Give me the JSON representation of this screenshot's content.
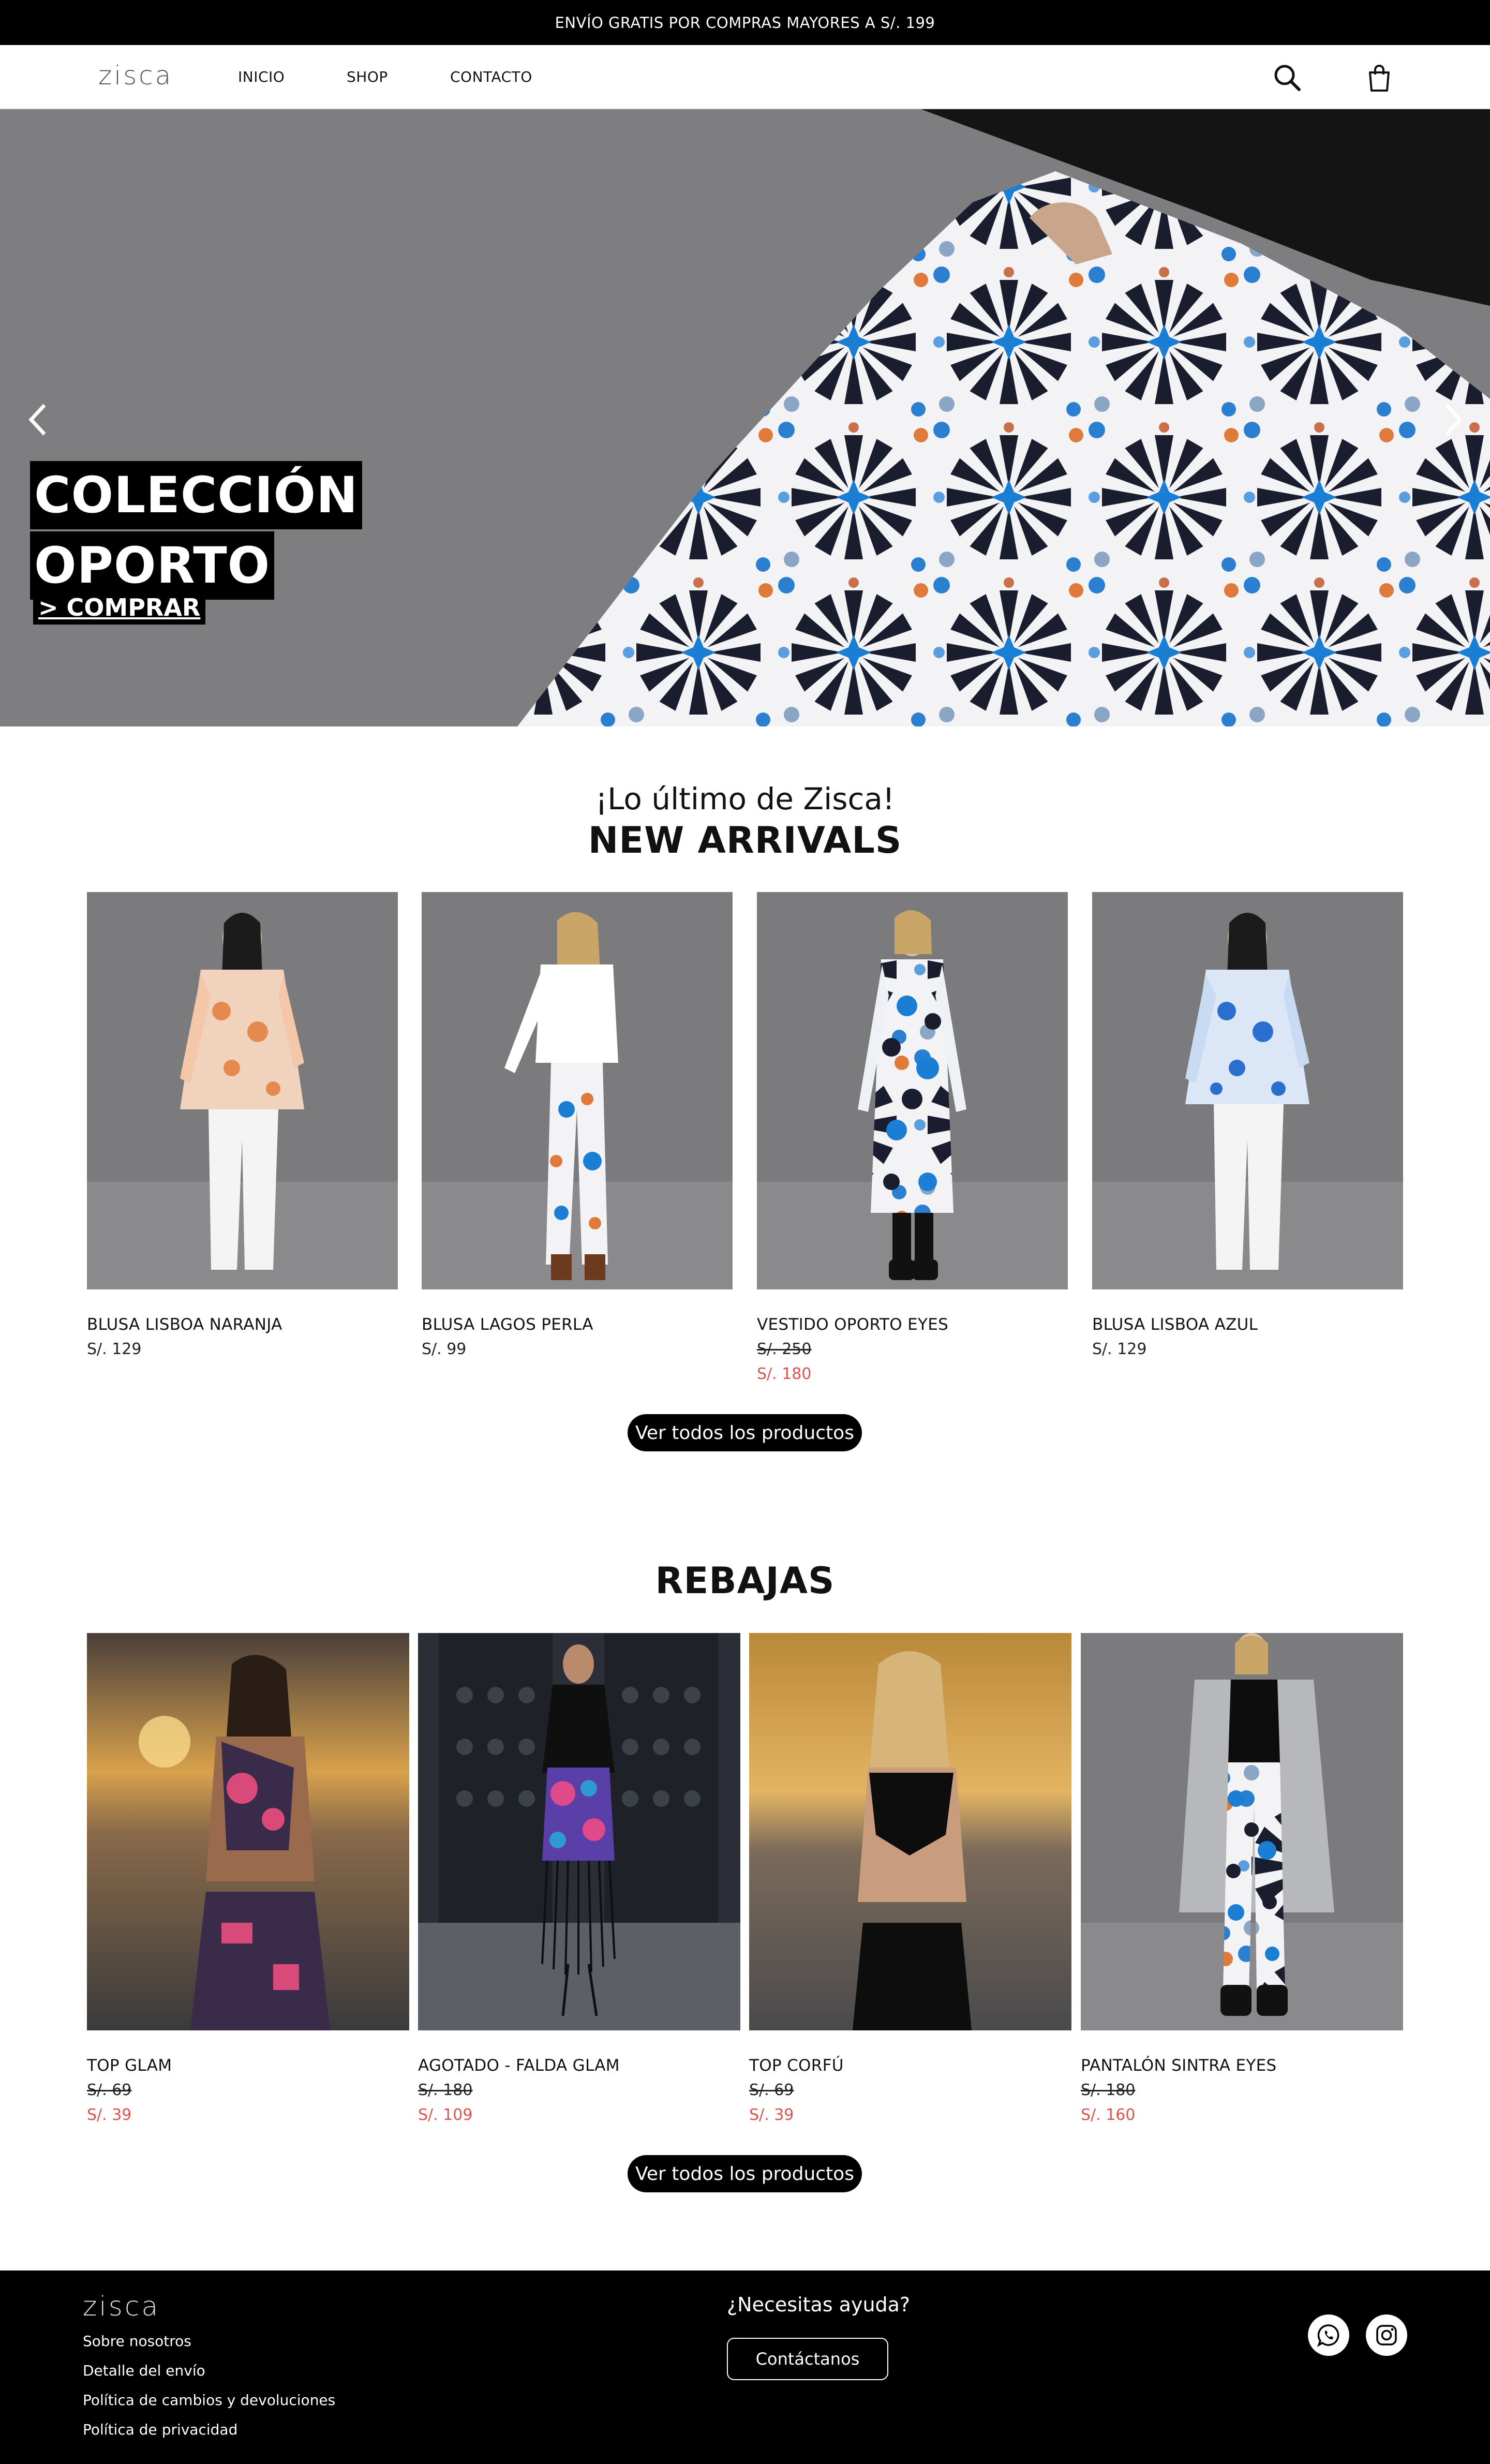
{
  "announcement": "ENVÍO GRATIS POR COMPRAS MAYORES A S/. 199",
  "header": {
    "logo": "zisca",
    "nav": [
      "INICIO",
      "SHOP",
      "CONTACTO"
    ],
    "icons": [
      "search-icon",
      "cart-icon"
    ]
  },
  "hero": {
    "title_line1": "COLECCIÓN",
    "title_line2": "OPORTO",
    "cta": "> COMPRAR",
    "slides": 3,
    "active_slide": 1
  },
  "new_arrivals": {
    "subtitle": "¡Lo último de Zisca!",
    "title": "NEW ARRIVALS",
    "products": [
      {
        "name": "BLUSA LISBOA NARANJA",
        "price": "S/. 129"
      },
      {
        "name": "BLUSA LAGOS PERLA",
        "price": "S/. 99"
      },
      {
        "name": "VESTIDO OPORTO EYES",
        "old_price": "S/. 250",
        "sale_price": "S/. 180"
      },
      {
        "name": "BLUSA LISBOA AZUL",
        "price": "S/. 129"
      }
    ],
    "button": "Ver todos los productos"
  },
  "sale": {
    "title": "REBAJAS",
    "products": [
      {
        "name": "TOP GLAM",
        "old_price": "S/. 69",
        "sale_price": "S/. 39"
      },
      {
        "name": "AGOTADO - FALDA GLAM",
        "old_price": "S/. 180",
        "sale_price": "S/. 109"
      },
      {
        "name": "TOP CORFÚ",
        "old_price": "S/. 69",
        "sale_price": "S/. 39"
      },
      {
        "name": "PANTALÓN SINTRA EYES",
        "old_price": "S/. 180",
        "sale_price": "S/. 160"
      }
    ],
    "button": "Ver todos los productos"
  },
  "footer": {
    "logo": "zisca",
    "links": [
      "Sobre nosotros",
      "Detalle del envío",
      "Política de cambios y devoluciones",
      "Política de privacidad"
    ],
    "help_title": "¿Necesitas ayuda?",
    "contact_button": "Contáctanos",
    "social": [
      "whatsapp-icon",
      "instagram-icon"
    ]
  },
  "colors": {
    "sale_red": "#d9534f",
    "black": "#000000",
    "studio_gray": "#7a7a7d"
  }
}
